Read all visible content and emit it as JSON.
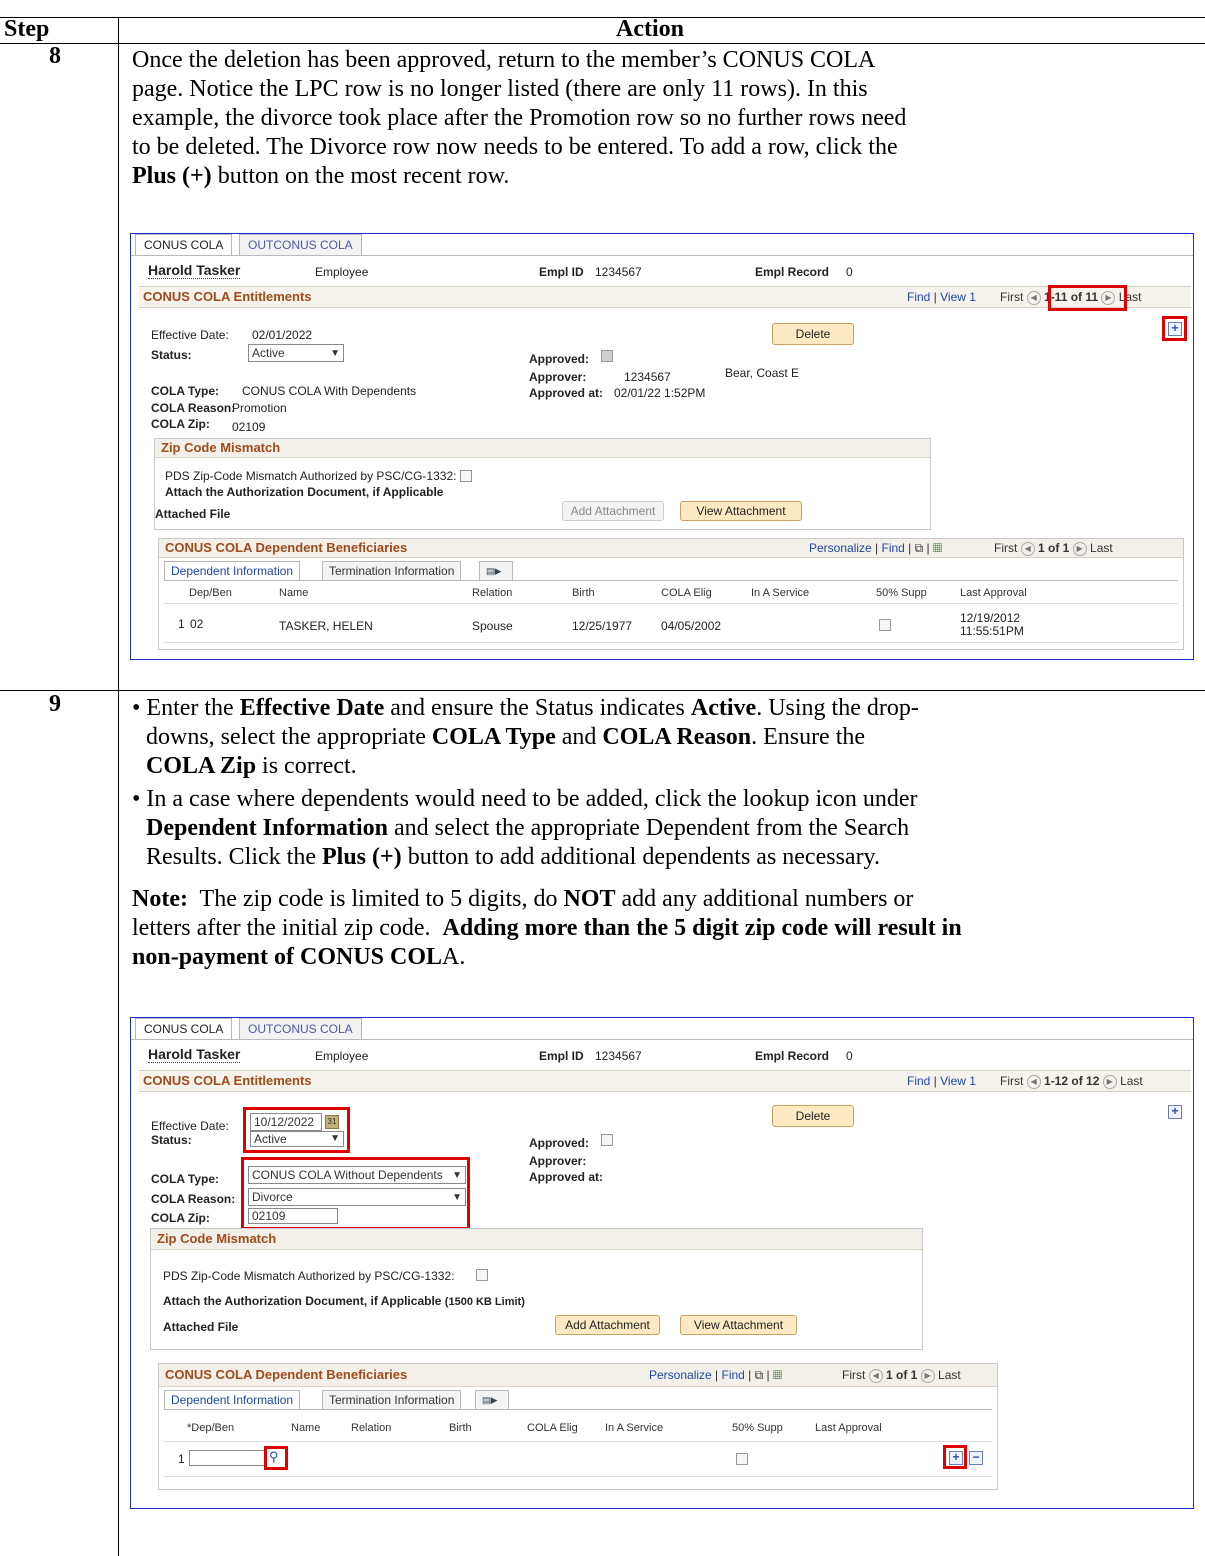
{
  "table": {
    "col_step": "Step",
    "col_action": "Action"
  },
  "step8": {
    "number": "8",
    "text_lines": [
      "Once the deletion has been approved, return to the member’s CONUS COLA",
      "page.  Notice the LPC row is no longer listed (there are only 11 rows).  In this",
      "example, the divorce took place after the Promotion row so no further rows need",
      "to be deleted.  The Divorce row now needs to be entered.  To add a row, click the"
    ],
    "last_line_bold": "Plus",
    "last_line_plus": "(+)",
    "last_line_rest": " button on the most recent row."
  },
  "shot1": {
    "tab_active": "CONUS COLA",
    "tab_inactive": "OUTCONUS COLA",
    "name": "Harold Tasker",
    "role": "Employee",
    "emplid_label": "Empl ID",
    "emplid": "1234567",
    "emplrec_label": "Empl Record",
    "emplrec": "0",
    "section_title": "CONUS COLA Entitlements",
    "find": "Find",
    "view1": "View 1",
    "first": "First",
    "range": "1-11 of 11",
    "last": "Last",
    "eff_label": "Effective Date:",
    "eff_value": "02/01/2022",
    "status_label": "Status:",
    "status_value": "Active",
    "delete": "Delete",
    "approved_label": "Approved:",
    "approver_label": "Approver:",
    "approver_id": "1234567",
    "approver_name": "Bear, Coast E",
    "approved_at_label": "Approved at:",
    "approved_at": "02/01/22  1:52PM",
    "cola_type_label": "COLA Type:",
    "cola_type": "CONUS COLA With Dependents",
    "cola_reason_label": "COLA Reason:",
    "cola_reason": "Promotion",
    "cola_zip_label": "COLA Zip:",
    "cola_zip": "02109",
    "zip_mismatch": "Zip Code Mismatch",
    "pds_label": "PDS Zip-Code Mismatch Authorized by PSC/CG-1332:",
    "attach_doc": "Attach the Authorization Document, if Applicable",
    "attached_file": "Attached File",
    "add_attachment": "Add Attachment",
    "view_attachment": "View Attachment",
    "dep_title": "CONUS COLA Dependent Beneficiaries",
    "personalize": "Personalize",
    "dep_first": "First",
    "dep_range": "1 of 1",
    "dep_last": "Last",
    "subtab1": "Dependent Information",
    "subtab2": "Termination Information",
    "cols": [
      "Dep/Ben",
      "Name",
      "Relation",
      "Birth",
      "COLA Elig",
      "In A Service",
      "50% Supp",
      "Last Approval"
    ],
    "row": {
      "num": "1",
      "depben": "02",
      "name": "TASKER, HELEN",
      "relation": "Spouse",
      "birth": "12/25/1977",
      "elig": "04/05/2002",
      "approval_date": "12/19/2012",
      "approval_time": "11:55:51PM"
    }
  },
  "step9": {
    "number": "9",
    "b1": {
      "l1_pre": "Enter the ",
      "l1_b1": "Effective Date",
      "l1_mid": " and ensure the Status indicates ",
      "l1_b2": "Active",
      "l1_post": ".  Using the drop-",
      "l2_pre": "downs, select the appropriate ",
      "l2_b1": "COLA Type",
      "l2_mid": " and ",
      "l2_b2": "COLA Reason",
      "l2_post": ".  Ensure the",
      "l3_b": "COLA Zip",
      "l3_post": " is correct."
    },
    "b2": {
      "l1": "In a case where dependents would need to be added, click the lookup icon under",
      "l2_b": "Dependent Information",
      "l2_post": " and select the appropriate Dependent from the Search",
      "l3_pre": "Results.  Click the ",
      "l3_b": "Plus",
      "l3_plus": "(+)",
      "l3_post": " button to add additional dependents as necessary."
    },
    "note": {
      "label": "Note:",
      "l1_pre": "  The zip code is limited to 5 digits, do ",
      "l1_b": "NOT",
      "l1_post": " add any additional numbers or",
      "l2_pre": "letters after the initial zip code.  ",
      "l2_b": "Adding more than the 5 digit zip code will result in",
      "l3_b": "non-payment of CONUS COL",
      "l3_post": "A."
    }
  },
  "shot2": {
    "tab_active": "CONUS COLA",
    "tab_inactive": "OUTCONUS COLA",
    "name": "Harold Tasker",
    "role": "Employee",
    "emplid_label": "Empl ID",
    "emplid": "1234567",
    "emplrec_label": "Empl Record",
    "emplrec": "0",
    "section_title": "CONUS COLA Entitlements",
    "find": "Find",
    "view1": "View 1",
    "first": "First",
    "range": "1-12 of 12",
    "last": "Last",
    "eff_label": "Effective Date:",
    "eff_value": "10/12/2022",
    "status_label": "Status:",
    "status_value": "Active",
    "delete": "Delete",
    "approved_label": "Approved:",
    "approver_label": "Approver:",
    "approved_at_label": "Approved at:",
    "cola_type_label": "COLA Type:",
    "cola_type": "CONUS COLA Without Dependents",
    "cola_reason_label": "COLA Reason:",
    "cola_reason": "Divorce",
    "cola_zip_label": "COLA Zip:",
    "cola_zip": "02109",
    "zip_mismatch": "Zip Code Mismatch",
    "pds_label": "PDS Zip-Code Mismatch Authorized by PSC/CG-1332:",
    "attach_doc": "Attach the Authorization Document, if Applicable",
    "limit": "(1500 KB Limit)",
    "attached_file": "Attached File",
    "add_attachment": "Add Attachment",
    "view_attachment": "View Attachment",
    "dep_title": "CONUS COLA Dependent Beneficiaries",
    "personalize": "Personalize",
    "dep_first": "First",
    "dep_range": "1 of 1",
    "dep_last": "Last",
    "subtab1": "Dependent Information",
    "subtab2": "Termination Information",
    "cols": [
      "*Dep/Ben",
      "Name",
      "Relation",
      "Birth",
      "COLA Elig",
      "In A Service",
      "50% Supp",
      "Last Approval"
    ],
    "row_num": "1"
  }
}
